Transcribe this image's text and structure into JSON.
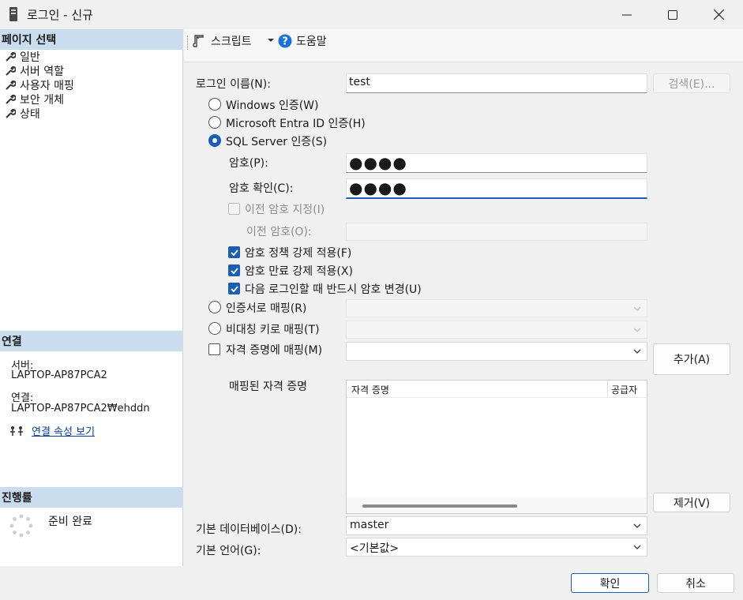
{
  "window": {
    "title": "로그인 - 신규"
  },
  "left": {
    "select_page_header": "페이지 선택",
    "pages": [
      {
        "label": "일반"
      },
      {
        "label": "서버 역할"
      },
      {
        "label": "사용자 매핑"
      },
      {
        "label": "보안 개체"
      },
      {
        "label": "상태"
      }
    ],
    "connection_header": "연결",
    "server_label": "서버:",
    "server_value": "LAPTOP-AP87PCA2",
    "connection_label": "연결:",
    "connection_value": "LAPTOP-AP87PCA2₩ehddn",
    "view_conn_props": "연결 속성 보기",
    "progress_header": "진행률",
    "progress_status": "준비 완료"
  },
  "toolbar": {
    "script_label": "스크립트",
    "help_label": "도움말"
  },
  "form": {
    "login_name_label": "로그인 이름(N):",
    "login_name_value": "test",
    "search_button": "검색(E)...",
    "auth_windows": "Windows 인증(W)",
    "auth_entra": "Microsoft Entra ID 인증(H)",
    "auth_sql": "SQL Server 인증(S)",
    "password_label": "암호(P):",
    "password_value": "●●●●",
    "confirm_label": "암호 확인(C):",
    "confirm_value": "●●●●",
    "old_password_check": "이전 암호 지정(I)",
    "old_password_label": "이전 암호(O):",
    "enforce_policy": "암호 정책 강제 적용(F)",
    "enforce_expiration": "암호 만료 강제 적용(X)",
    "must_change": "다음 로그인할 때 반드시 암호 변경(U)",
    "map_cert": "인증서로 매핑(R)",
    "map_asym": "비대칭 키로 매핑(T)",
    "map_credential": "자격 증명에 매핑(M)",
    "add_button": "추가(A)",
    "mapped_credentials_label": "매핑된 자격 증명",
    "grid_col_credential": "자격 증명",
    "grid_col_provider": "공급자",
    "remove_button": "제거(V)",
    "default_db_label": "기본 데이터베이스(D):",
    "default_db_value": "master",
    "default_lang_label": "기본 언어(G):",
    "default_lang_value": "<기본값>"
  },
  "footer": {
    "ok_button": "확인",
    "cancel_button": "취소"
  },
  "colors": {
    "accent": "#1a5fb4",
    "section_header": "#c9ddee"
  },
  "icons": [
    "app-icon",
    "minimize-icon",
    "maximize-icon",
    "close-icon",
    "wrench-icon",
    "script-icon",
    "dropdown-icon",
    "help-icon",
    "connection-icon",
    "spinner-icon",
    "chevron-down-icon",
    "checkmark-icon"
  ]
}
